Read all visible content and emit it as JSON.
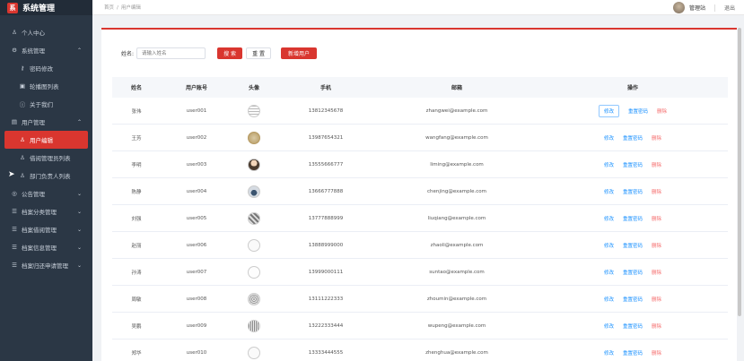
{
  "brand": {
    "logo": "系",
    "title": "系统管理"
  },
  "sidebar": {
    "items": [
      {
        "label": "个人中心",
        "icon": "user-icon",
        "glyph": "♙",
        "arrow": ""
      },
      {
        "label": "系统管理",
        "icon": "gear-icon",
        "glyph": "⚙",
        "arrow": "⌃"
      },
      {
        "label": "密码修改",
        "icon": "key-icon",
        "glyph": "⚷",
        "arrow": ""
      },
      {
        "label": "轮播图列表",
        "icon": "image-icon",
        "glyph": "▣",
        "arrow": ""
      },
      {
        "label": "关于我们",
        "icon": "info-icon",
        "glyph": "ⓘ",
        "arrow": ""
      },
      {
        "label": "用户管理",
        "icon": "users-icon",
        "glyph": "▤",
        "arrow": "⌃"
      },
      {
        "label": "用户编辑",
        "icon": "user-icon",
        "glyph": "♙",
        "arrow": ""
      },
      {
        "label": "借阅管理员列表",
        "icon": "user-icon",
        "glyph": "♙",
        "arrow": ""
      },
      {
        "label": "部门负责人列表",
        "icon": "user-icon",
        "glyph": "♙",
        "arrow": ""
      },
      {
        "label": "公告管理",
        "icon": "bell-icon",
        "glyph": "◎",
        "arrow": "⌄"
      },
      {
        "label": "档案分类管理",
        "icon": "list-icon",
        "glyph": "☰",
        "arrow": "⌄"
      },
      {
        "label": "档案借阅管理",
        "icon": "list-icon",
        "glyph": "☰",
        "arrow": "⌄"
      },
      {
        "label": "档案信息管理",
        "icon": "list-icon",
        "glyph": "☰",
        "arrow": "⌄"
      },
      {
        "label": "档案归还申请管理",
        "icon": "list-icon",
        "glyph": "☰",
        "arrow": "⌄"
      }
    ]
  },
  "breadcrumb": {
    "home": "首页",
    "sep": "/",
    "current": "用户编辑"
  },
  "header": {
    "username": "管理站",
    "logout": "退出"
  },
  "search": {
    "label": "姓名:",
    "placeholder": "请输入姓名",
    "search_btn": "搜 索",
    "reset_btn": "重 置",
    "add_btn": "新增用户"
  },
  "table": {
    "headers": [
      "姓名",
      "用户账号",
      "头像",
      "手机",
      "邮箱",
      "操作"
    ],
    "rows": [
      {
        "name": "张伟",
        "account": "user001",
        "phone": "13812345678",
        "email": "zhangwei@example.com"
      },
      {
        "name": "王芳",
        "account": "user002",
        "phone": "13987654321",
        "email": "wangfang@example.com"
      },
      {
        "name": "李明",
        "account": "user003",
        "phone": "13555666777",
        "email": "liming@example.com"
      },
      {
        "name": "陈静",
        "account": "user004",
        "phone": "13666777888",
        "email": "chenjing@example.com"
      },
      {
        "name": "刘强",
        "account": "user005",
        "phone": "13777888999",
        "email": "liuqiang@example.com"
      },
      {
        "name": "赵丽",
        "account": "user006",
        "phone": "13888999000",
        "email": "zhaoli@example.com"
      },
      {
        "name": "孙涛",
        "account": "user007",
        "phone": "13999000111",
        "email": "suntao@example.com"
      },
      {
        "name": "周敏",
        "account": "user008",
        "phone": "13111222333",
        "email": "zhoumin@example.com"
      },
      {
        "name": "吴鹏",
        "account": "user009",
        "phone": "13222333444",
        "email": "wupeng@example.com"
      },
      {
        "name": "郑华",
        "account": "user010",
        "phone": "13333444555",
        "email": "zhenghua@example.com"
      }
    ],
    "ops": {
      "edit": "修改",
      "reset_pwd": "重置密码",
      "delete": "删除"
    }
  },
  "colors": {
    "accent": "#d9362f",
    "sidebar_bg": "#2b3745",
    "link": "#1890ff",
    "danger": "#f56c6c"
  }
}
